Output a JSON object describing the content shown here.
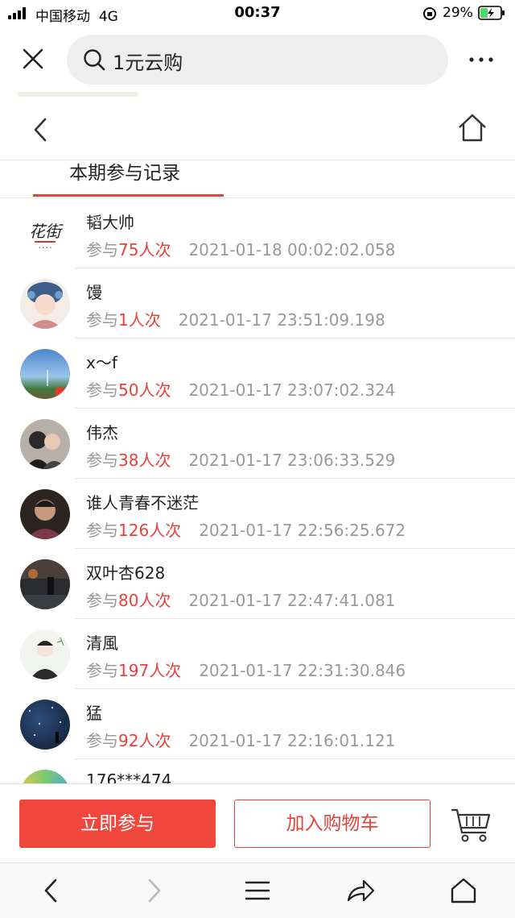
{
  "status_bar": {
    "carrier": "中国移动",
    "network": "4G",
    "time": "00:37",
    "battery": "29%"
  },
  "search": {
    "query": "1元云购"
  },
  "tabs": {
    "active": "本期参与记录"
  },
  "labels": {
    "participate_prefix": "参与",
    "unit": "人次"
  },
  "records": [
    {
      "name": "韬大帅",
      "count": "75",
      "time": "2021-01-18 00:02:02.058",
      "avatar": "logo-text-avatar"
    },
    {
      "name": "馒",
      "count": "1",
      "time": "2021-01-17 23:51:09.198",
      "avatar": "illustration-avatar"
    },
    {
      "name": "x～f",
      "count": "50",
      "time": "2021-01-17 23:07:02.324",
      "avatar": "sky-avatar"
    },
    {
      "name": "伟杰",
      "count": "38",
      "time": "2021-01-17 23:06:33.529",
      "avatar": "couple-avatar"
    },
    {
      "name": "谁人青春不迷茫",
      "count": "126",
      "time": "2021-01-17 22:56:25.672",
      "avatar": "portrait-avatar"
    },
    {
      "name": "双叶杏628",
      "count": "80",
      "time": "2021-01-17 22:47:41.081",
      "avatar": "night-avatar"
    },
    {
      "name": "清風",
      "count": "197",
      "time": "2021-01-17 22:31:30.846",
      "avatar": "sketch-avatar"
    },
    {
      "name": "猛",
      "count": "92",
      "time": "2021-01-17 22:16:01.121",
      "avatar": "starry-avatar"
    },
    {
      "name": "176***474",
      "count": "",
      "time": "",
      "avatar": "colorful-avatar"
    }
  ],
  "actions": {
    "join": "立即参与",
    "add_to_cart": "加入购物车"
  },
  "colors": {
    "accent": "#e5423a",
    "button_red": "#f0473d",
    "muted_text": "#999999"
  }
}
